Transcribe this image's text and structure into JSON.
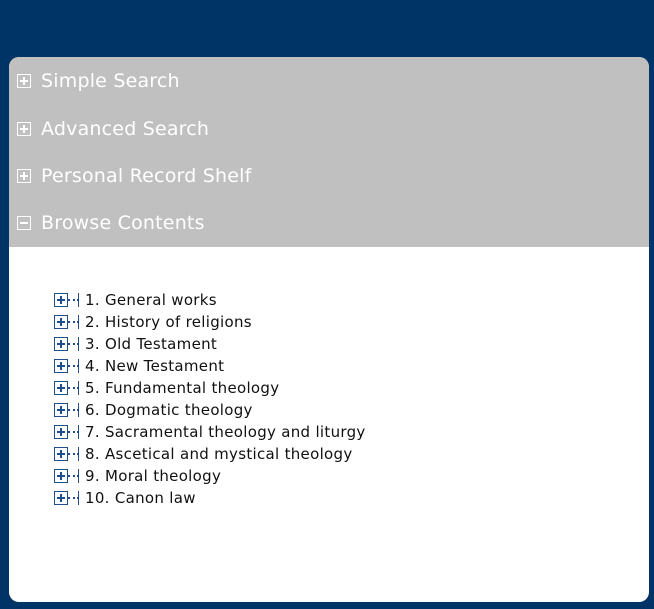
{
  "menu": {
    "items": [
      {
        "label": "Simple Search",
        "icon": "plus-box-icon"
      },
      {
        "label": "Advanced Search",
        "icon": "plus-box-icon"
      },
      {
        "label": "Personal Record Shelf",
        "icon": "plus-box-icon"
      },
      {
        "label": "Browse Contents",
        "icon": "minus-box-icon"
      }
    ]
  },
  "tree": {
    "items": [
      {
        "label": "1. General works"
      },
      {
        "label": "2. History of religions"
      },
      {
        "label": "3. Old Testament"
      },
      {
        "label": "4. New Testament"
      },
      {
        "label": "5. Fundamental theology"
      },
      {
        "label": "6. Dogmatic theology"
      },
      {
        "label": "7. Sacramental theology and liturgy"
      },
      {
        "label": "8. Ascetical and mystical theology"
      },
      {
        "label": "9. Moral theology"
      },
      {
        "label": "10. Canon law"
      }
    ]
  },
  "colors": {
    "header_background": "#003366",
    "menu_background": "#c0c0c0",
    "menu_text": "#ffffff",
    "tree_icon": "#1f4e8c"
  }
}
